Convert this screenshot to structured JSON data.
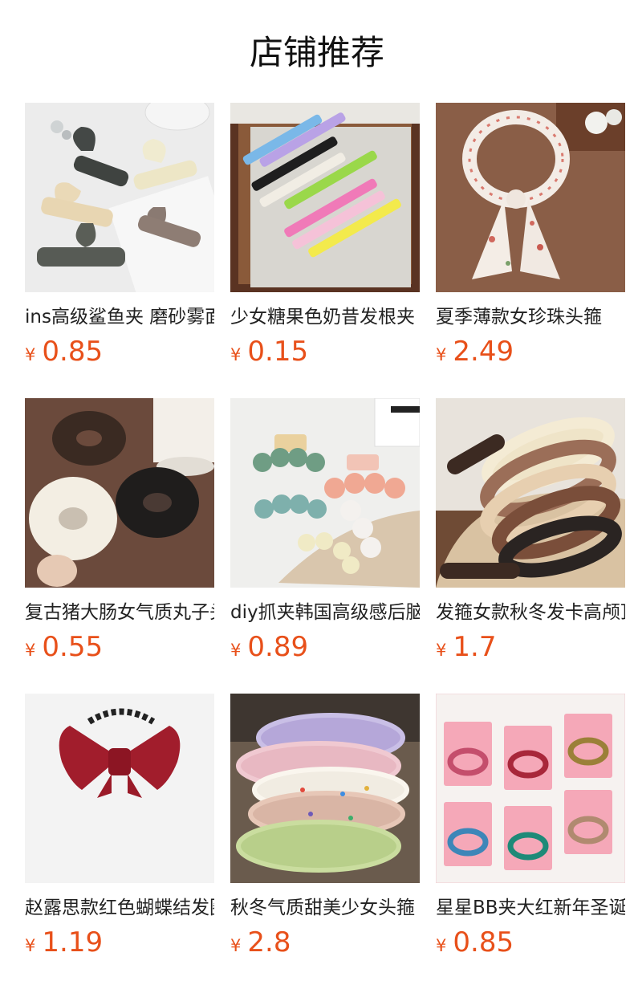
{
  "header": {
    "title": "店铺推荐"
  },
  "products": [
    {
      "name": "ins高级鲨鱼夹 磨砂雾面抓夹",
      "currency": "¥",
      "price": "0.85",
      "image": "black-beige-claw-clips"
    },
    {
      "name": "少女糖果色奶昔发根夹",
      "currency": "¥",
      "price": "0.15",
      "image": "candy-color-duckbill-clips"
    },
    {
      "name": "夏季薄款女珍珠头箍",
      "currency": "¥",
      "price": "2.49",
      "image": "floral-bow-headband"
    },
    {
      "name": "复古猪大肠女气质丸子头",
      "currency": "¥",
      "price": "0.55",
      "image": "scrunchies"
    },
    {
      "name": "diy抓夹韩国高级感后脑勺",
      "currency": "¥",
      "price": "0.89",
      "image": "bead-claw-clips"
    },
    {
      "name": "发箍女款秋冬发卡高颅顶",
      "currency": "¥",
      "price": "1.7",
      "image": "padded-headbands"
    },
    {
      "name": "赵露思款红色蝴蝶结发圈",
      "currency": "¥",
      "price": "1.19",
      "image": "red-bow-hair-tie"
    },
    {
      "name": "秋冬气质甜美少女头箍",
      "currency": "¥",
      "price": "2.8",
      "image": "tweed-headbands"
    },
    {
      "name": "星星BB夹大红新年圣诞",
      "currency": "¥",
      "price": "0.85",
      "image": "fluffy-bb-clips"
    }
  ]
}
